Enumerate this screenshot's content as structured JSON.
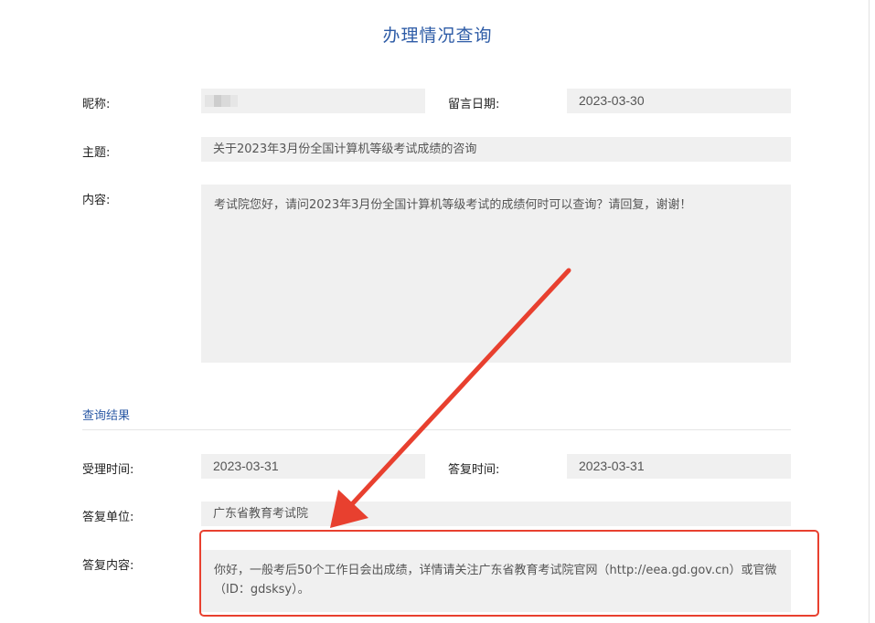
{
  "page": {
    "title": "办理情况查询"
  },
  "message": {
    "nickname_label": "昵称:",
    "nickname_value": "",
    "date_label": "留言日期:",
    "date_value": "2023-03-30",
    "subject_label": "主题:",
    "subject_value": "关于2023年3月份全国计算机等级考试成绩的咨询",
    "content_label": "内容:",
    "content_value": "考试院您好，请问2023年3月份全国计算机等级考试的成绩何时可以查询？请回复，谢谢！"
  },
  "result": {
    "section_title": "查询结果",
    "accept_time_label": "受理时间:",
    "accept_time_value": "2023-03-31",
    "reply_time_label": "答复时间:",
    "reply_time_value": "2023-03-31",
    "reply_unit_label": "答复单位:",
    "reply_unit_value": "广东省教育考试院",
    "reply_content_label": "答复内容:",
    "reply_content_value": "你好，一般考后50个工作日会出成绩，详情请关注广东省教育考试院官网（http://eea.gd.gov.cn）或官微（ID：gdsksy）。"
  },
  "annotation": {
    "arrow_color": "#e8402f",
    "box_color": "#e8402f"
  },
  "colors": {
    "accent": "#2d5ba6",
    "field_bg": "#f0f0f0"
  }
}
